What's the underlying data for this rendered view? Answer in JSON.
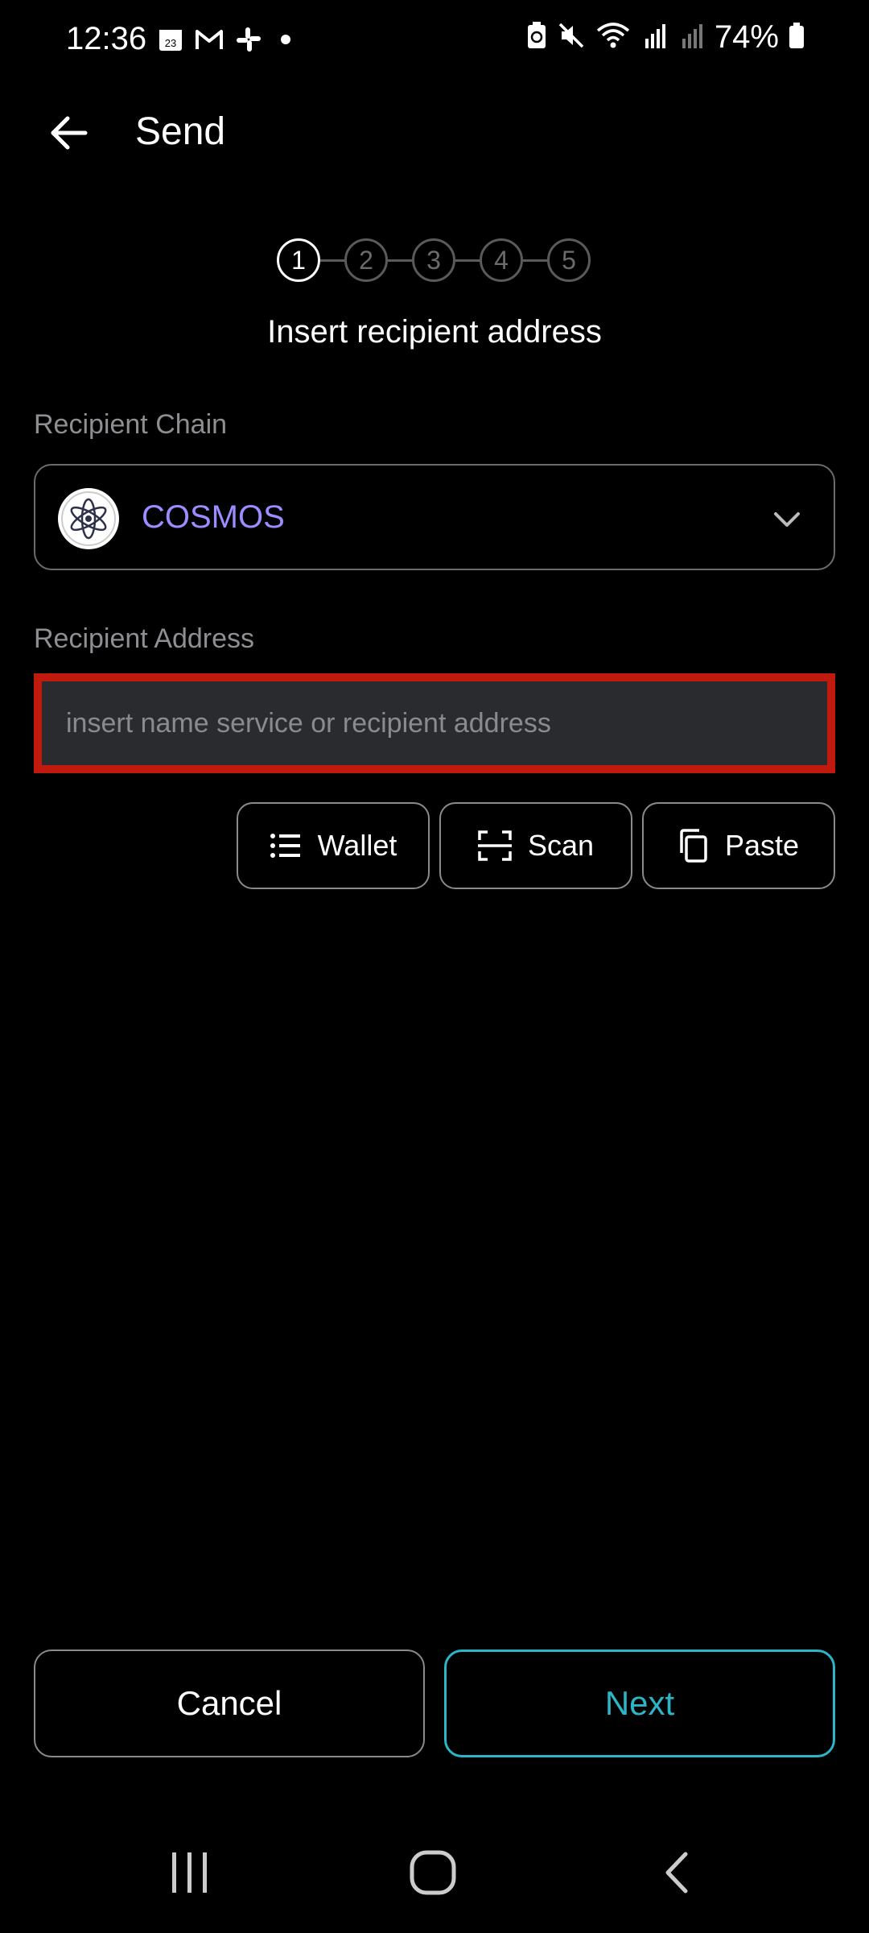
{
  "status_bar": {
    "time": "12:36",
    "battery": "74%",
    "left_icons": [
      "calendar-icon",
      "gmail-icon",
      "slack-icon",
      "dot-icon"
    ],
    "right_icons": [
      "battery-saver-icon",
      "mute-icon",
      "wifi-icon",
      "signal-icon",
      "signal-weak-icon",
      "battery-icon"
    ],
    "calendar_day": "23"
  },
  "app_bar": {
    "title": "Send"
  },
  "stepper": {
    "steps": [
      "1",
      "2",
      "3",
      "4",
      "5"
    ],
    "active_step": "1",
    "title": "Insert recipient address"
  },
  "recipient_chain": {
    "label": "Recipient Chain",
    "value": "COSMOS"
  },
  "recipient_address": {
    "label": "Recipient Address",
    "value": "",
    "placeholder": "insert name service or recipient address"
  },
  "actions": {
    "wallet_label": "Wallet",
    "scan_label": "Scan",
    "paste_label": "Paste"
  },
  "footer": {
    "cancel_label": "Cancel",
    "next_label": "Next"
  },
  "colors": {
    "background": "#000000",
    "accent": "#2ab6c6",
    "chain_name": "#9b8cff",
    "highlight_border": "#c01a0e",
    "input_bg": "#2a2b2f"
  }
}
